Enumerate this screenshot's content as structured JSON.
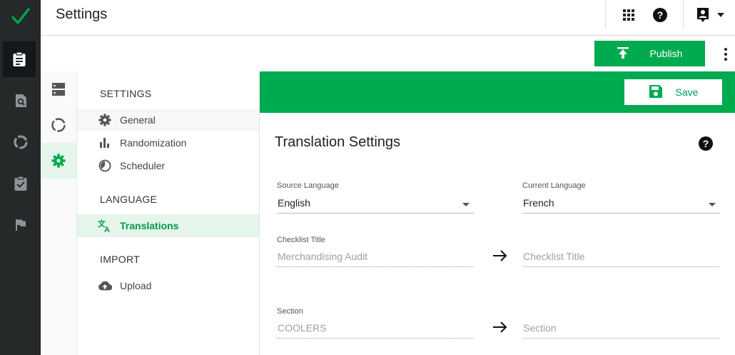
{
  "app": {
    "logo_icon": "checkmark-logo-icon",
    "accent": "#00aa4f",
    "rail_bg": "#25292a"
  },
  "rail": {
    "items": [
      {
        "name": "checklist-clipboard-icon",
        "active": true
      },
      {
        "name": "search-document-icon",
        "active": false
      },
      {
        "name": "donut-chart-icon",
        "active": false
      },
      {
        "name": "clipboard-check-icon",
        "active": false
      },
      {
        "name": "flag-icon",
        "active": false
      }
    ]
  },
  "header": {
    "title": "Settings",
    "apps_icon": "apps-grid-icon",
    "help_icon": "help-icon",
    "account_icon": "account-box-icon",
    "account_menu_icon": "chevron-down-icon"
  },
  "toolbar": {
    "publish_label": "Publish",
    "publish_icon": "upload-icon",
    "more_icon": "more-vertical-icon"
  },
  "subrail": {
    "items": [
      {
        "name": "server-icon",
        "active": false
      },
      {
        "name": "donut-chart-icon",
        "active": false
      },
      {
        "name": "gear-icon",
        "active": true
      }
    ]
  },
  "menu": {
    "sections": [
      {
        "title": "SETTINGS",
        "items": [
          {
            "label": "General",
            "icon": "gear-icon"
          },
          {
            "label": "Randomization",
            "icon": "bar-chart-icon"
          },
          {
            "label": "Scheduler",
            "icon": "timer-icon"
          }
        ]
      },
      {
        "title": "LANGUAGE",
        "items": [
          {
            "label": "Translations",
            "icon": "translate-icon"
          }
        ]
      },
      {
        "title": "IMPORT",
        "items": [
          {
            "label": "Upload",
            "icon": "cloud-upload-icon"
          }
        ]
      }
    ]
  },
  "content": {
    "save_label": "Save",
    "save_icon": "floppy-disk-icon",
    "heading": "Translation Settings",
    "help_icon": "help-icon",
    "source_language": {
      "label": "Source Language",
      "value": "English"
    },
    "current_language": {
      "label": "Current Language",
      "value": "French"
    },
    "checklist_title": {
      "label": "Checklist Title",
      "source": "Merchandising Audit",
      "placeholder": "Checklist Title"
    },
    "section": {
      "label": "Section",
      "source": "COOLERS",
      "placeholder": "Section"
    }
  }
}
